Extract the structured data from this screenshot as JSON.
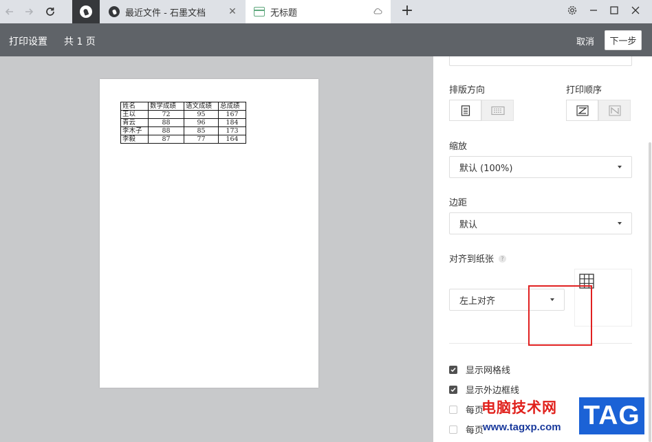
{
  "browser": {
    "tabs": [
      {
        "title": "最近文件 - 石墨文档",
        "icon": "shimo-logo-icon"
      },
      {
        "title": "无标题",
        "icon": "sheet-icon",
        "active": true
      }
    ],
    "new_tab": "+"
  },
  "header": {
    "title": "打印设置",
    "pages": "共 1 页",
    "cancel": "取消",
    "next": "下一步"
  },
  "preview": {
    "table": {
      "headers": [
        "姓名",
        "数学成绩",
        "语文成绩",
        "总成绩"
      ],
      "rows": [
        [
          "王以",
          "72",
          "95",
          "167"
        ],
        [
          "青云",
          "88",
          "96",
          "184"
        ],
        [
          "李木子",
          "88",
          "85",
          "173"
        ],
        [
          "李毅",
          "87",
          "77",
          "164"
        ]
      ]
    }
  },
  "panel": {
    "orientation_label": "排版方向",
    "order_label": "打印顺序",
    "zoom_label": "缩放",
    "zoom_value": "默认 (100%)",
    "margin_label": "边距",
    "margin_value": "默认",
    "align_label": "对齐到纸张",
    "align_help": "?",
    "align_value": "左上对齐",
    "checkboxes": [
      {
        "label": "显示网格线",
        "checked": true
      },
      {
        "label": "显示外边框线",
        "checked": true
      },
      {
        "label": "每页",
        "checked": false
      },
      {
        "label": "每页",
        "checked": false
      }
    ]
  },
  "watermark": {
    "site_name": "电脑技术网",
    "url": "www.tagxp.com",
    "tag": "TAG"
  },
  "colors": {
    "header_bg": "#5f6368",
    "highlight_border": "#e02020",
    "checkbox_checked": "#505050"
  }
}
